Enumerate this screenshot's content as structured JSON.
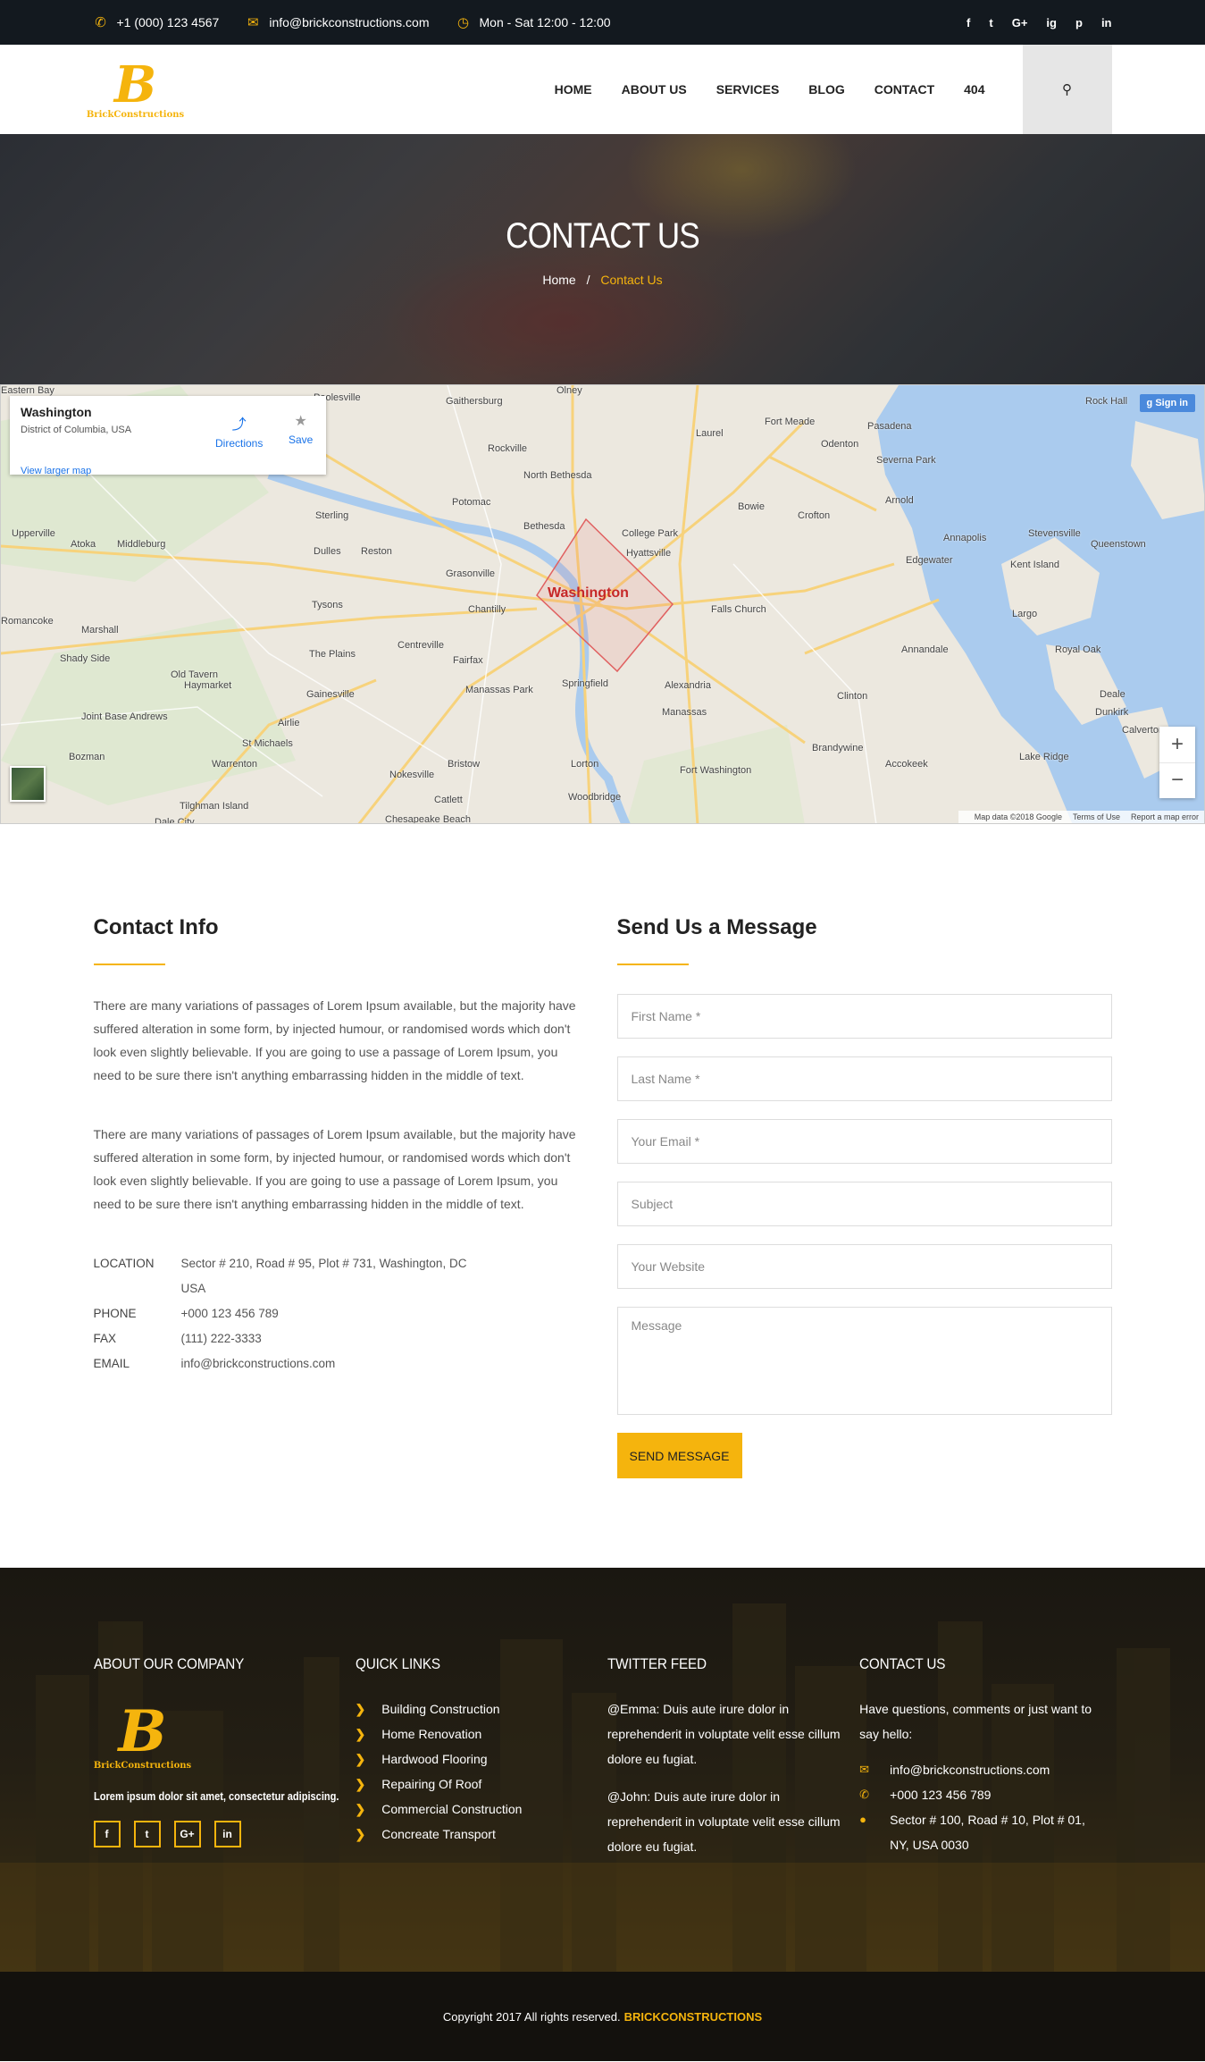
{
  "topbar": {
    "phone": "+1 (000) 123 4567",
    "email": "info@brickconstructions.com",
    "hours": "Mon - Sat 12:00 - 12:00",
    "social": [
      "f",
      "t",
      "G+",
      "ig",
      "p",
      "in"
    ]
  },
  "logo": {
    "letter": "B",
    "text": "BrickConstructions"
  },
  "nav": [
    "HOME",
    "ABOUT US",
    "SERVICES",
    "BLOG",
    "CONTACT",
    "404"
  ],
  "hero": {
    "title": "CONTACT US",
    "crumb_home": "Home",
    "crumb_sep": "/",
    "crumb_current": "Contact Us"
  },
  "map": {
    "place": "Washington",
    "place_sub": "District of Columbia, USA",
    "directions": "Directions",
    "save": "Save",
    "larger": "View larger map",
    "signin": "Sign in",
    "zoom_in": "+",
    "zoom_out": "−",
    "city_label": "Washington",
    "footer": [
      "Map data ©2018 Google",
      "Terms of Use",
      "Report a map error"
    ],
    "places": [
      "Poolesville",
      "Gaithersburg",
      "Olney",
      "Laurel",
      "Fort Meade",
      "Odenton",
      "Pasadena",
      "Rock Hall",
      "Rockville",
      "North Bethesda",
      "Severna Park",
      "Potomac",
      "Bowie",
      "Crofton",
      "Arnold",
      "Sterling",
      "Bethesda",
      "Annapolis",
      "Stevensville",
      "Upperville",
      "Atoka",
      "Middleburg",
      "Dulles",
      "Reston",
      "College Park",
      "Hyattsville",
      "Edgewater",
      "Kent Island",
      "Queenstown",
      "Grasonville",
      "Tysons",
      "Chantilly",
      "Falls Church",
      "Largo",
      "Romancoke",
      "Marshall",
      "The Plains",
      "Centreville",
      "Fairfax",
      "Annandale",
      "Shady Side",
      "Old Tavern",
      "Haymarket",
      "Gainesville",
      "Manassas Park",
      "Springfield",
      "Alexandria",
      "Joint Base Andrews",
      "Airlie",
      "Manassas",
      "Clinton",
      "Deale",
      "St Michaels",
      "Bristow",
      "Lorton",
      "Fort Washington",
      "Brandywine",
      "Dunkirk",
      "Bozman",
      "Warrenton",
      "Nokesville",
      "Lake Ridge",
      "Tilghman Island",
      "Catlett",
      "Woodbridge",
      "Accokeek",
      "Chesapeake Beach",
      "Dale City",
      "Calverton",
      "Royal Oak",
      "Eastern Bay"
    ]
  },
  "contact_info": {
    "title": "Contact Info",
    "paragraphs": [
      "There are many variations of passages of Lorem Ipsum available, but the majority have suffered alteration in some form, by injected humour, or randomised words which don't look even slightly believable. If you are going to use a passage of Lorem Ipsum, you need to be sure there isn't anything embarrassing hidden in the middle of text.",
      "There are many variations of passages of Lorem Ipsum available, but the majority have suffered alteration in some form, by injected humour, or randomised words which don't look even slightly believable. If you are going to use a passage of Lorem Ipsum, you need to be sure there isn't anything embarrassing hidden in the middle of text."
    ],
    "location_label": "LOCATION",
    "location": "Sector # 210, Road # 95, Plot # 731, Washington, DC USA",
    "phone_label": "PHONE",
    "phone": "+000 123 456 789",
    "fax_label": "FAX",
    "fax": "(111) 222-3333",
    "email_label": "EMAIL",
    "email": "info@brickconstructions.com"
  },
  "form": {
    "title": "Send Us a Message",
    "first_name": "First Name *",
    "last_name": "Last Name *",
    "email": "Your Email *",
    "subject": "Subject",
    "website": "Your Website",
    "message": "Message",
    "submit": "SEND MESSAGE"
  },
  "footer": {
    "about_title": "ABOUT OUR COMPANY",
    "tagline": "Lorem ipsum dolor sit amet, consectetur adipiscing.",
    "social": [
      "f",
      "t",
      "G+",
      "in"
    ],
    "links_title": "QUICK LINKS",
    "links": [
      "Building Construction",
      "Home Renovation",
      "Hardwood Flooring",
      "Repairing Of Roof",
      "Commercial Construction",
      "Concreate Transport"
    ],
    "twitter_title": "TWITTER FEED",
    "tweets": [
      "@Emma: Duis aute irure dolor in reprehenderit in voluptate velit esse cillum dolore eu fugiat.",
      "@John: Duis aute irure dolor in reprehenderit in voluptate velit esse cillum dolore eu fugiat."
    ],
    "contact_title": "CONTACT US",
    "contact_intro": "Have questions, comments or just want to say hello:",
    "contact_email": "info@brickconstructions.com",
    "contact_phone": "+000 123 456 789",
    "contact_address": "Sector # 100, Road # 10, Plot # 01, NY, USA 0030"
  },
  "copyright": {
    "text": "Copyright 2017 All rights reserved.",
    "brand": "BRICKCONSTRUCTIONS"
  },
  "colors": {
    "accent": "#f5b40d",
    "topbar": "#13191f",
    "footer_bottom": "#13110d"
  }
}
